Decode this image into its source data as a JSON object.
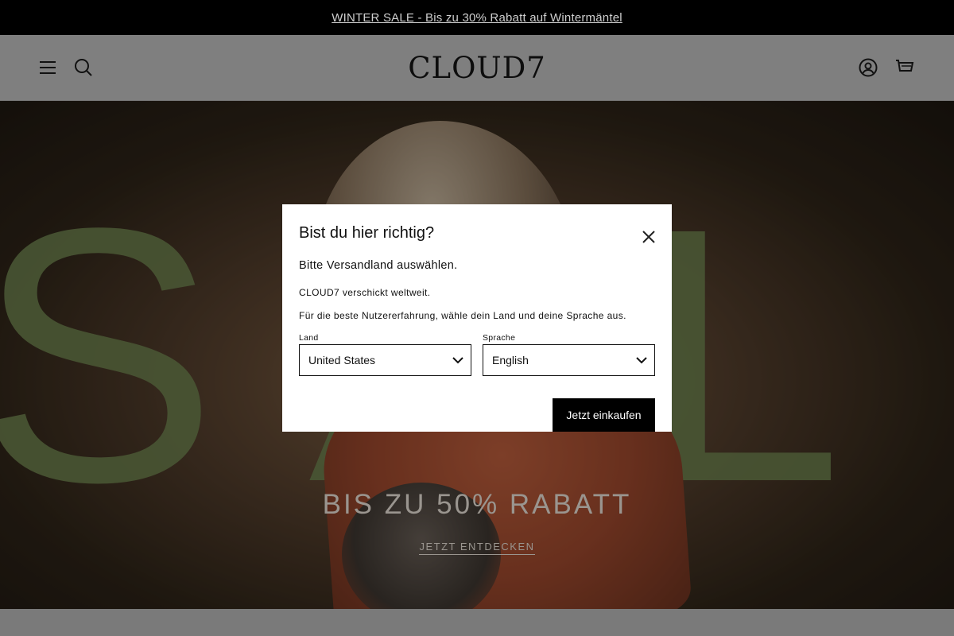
{
  "announcement": {
    "text": "WINTER SALE - Bis zu 30% Rabatt auf Wintermäntel"
  },
  "header": {
    "logo": "CLOUD7",
    "icons": [
      "menu-icon",
      "search-icon",
      "account-icon",
      "cart-icon"
    ]
  },
  "hero": {
    "background_word": "SALE",
    "title": "BIS ZU 50% RABATT",
    "link": "JETZT ENTDECKEN",
    "word_color": "#708450"
  },
  "modal": {
    "title": "Bist du hier richtig?",
    "subtitle": "Bitte Versandland auswählen.",
    "text1": "CLOUD7 verschickt weltweit.",
    "text2": "Für die beste Nutzererfahrung, wähle dein Land und deine Sprache aus.",
    "country": {
      "label": "Land",
      "value": "United States"
    },
    "language": {
      "label": "Sprache",
      "value": "English"
    },
    "button": "Jetzt einkaufen"
  },
  "colors": {
    "announcement_bg": "#000000",
    "button_bg": "#000000",
    "modal_bg": "#ffffff"
  }
}
